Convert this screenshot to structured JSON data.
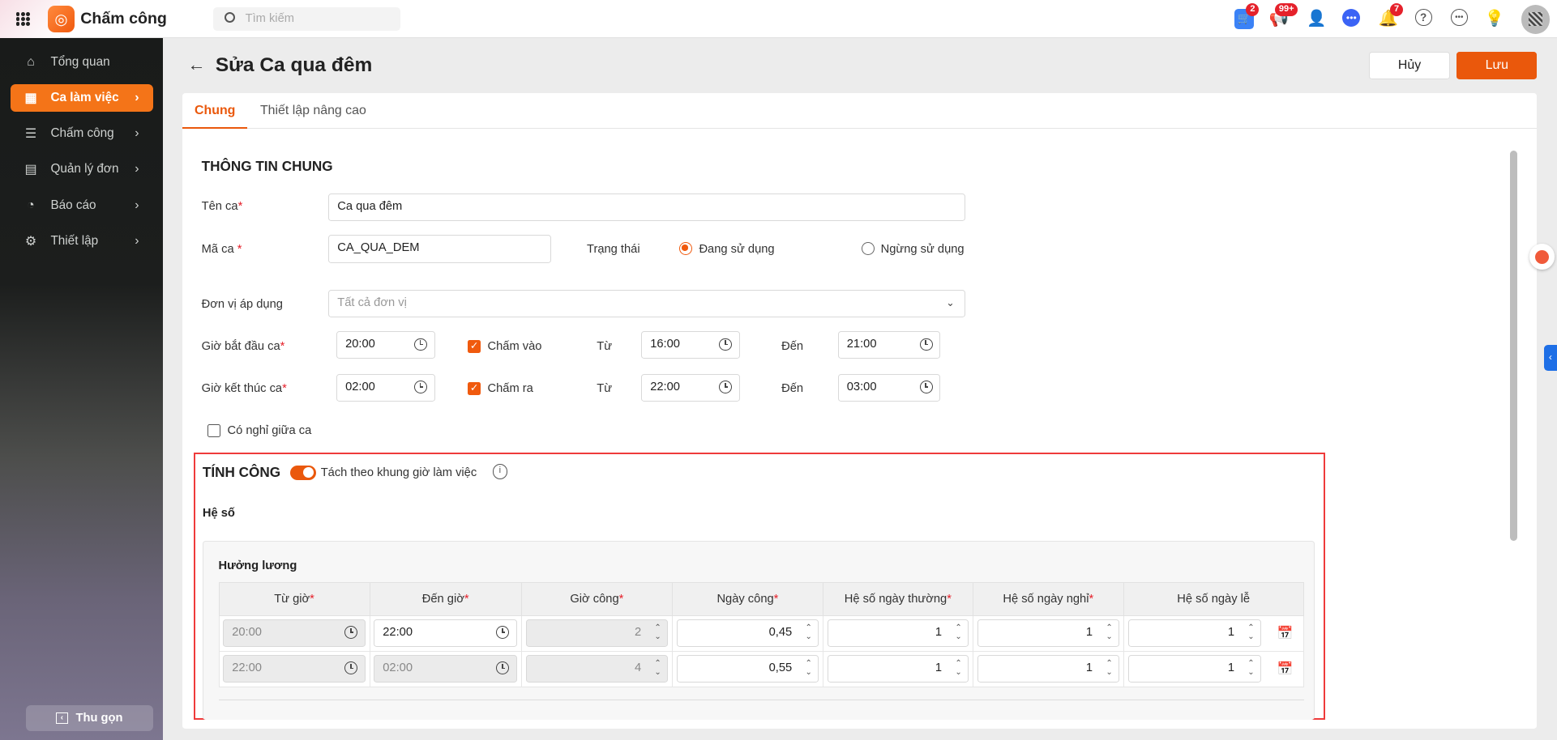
{
  "app": {
    "title": "Chấm công",
    "search_placeholder": "Tìm kiếm"
  },
  "header_icons": {
    "cart_badge": "2",
    "announce_badge": "99+",
    "bell_badge": "7"
  },
  "sidebar": {
    "items": [
      {
        "label": "Tổng quan"
      },
      {
        "label": "Ca làm việc"
      },
      {
        "label": "Chấm công"
      },
      {
        "label": "Quản lý đơn"
      },
      {
        "label": "Báo cáo"
      },
      {
        "label": "Thiết lập"
      }
    ],
    "collapse": "Thu gọn"
  },
  "page": {
    "title": "Sửa Ca qua đêm",
    "cancel": "Hủy",
    "save": "Lưu"
  },
  "tabs": [
    "Chung",
    "Thiết lập nâng cao"
  ],
  "general": {
    "heading": "THÔNG TIN CHUNG",
    "name_label": "Tên ca",
    "name_value": "Ca qua đêm",
    "code_label": "Mã ca",
    "code_value": "CA_QUA_DEM",
    "status_label": "Trạng thái",
    "status_active": "Đang sử dụng",
    "status_inactive": "Ngừng sử dụng",
    "unit_label": "Đơn vị áp dụng",
    "unit_placeholder": "Tất cả đơn vị",
    "start_label": "Giờ bắt đầu ca",
    "start_value": "20:00",
    "checkin_label": "Chấm vào",
    "from_label": "Từ",
    "to_label": "Đến",
    "checkin_from": "16:00",
    "checkin_to": "21:00",
    "end_label": "Giờ kết thúc ca",
    "end_value": "02:00",
    "checkout_label": "Chấm ra",
    "checkout_from": "22:00",
    "checkout_to": "03:00",
    "break_label": "Có nghỉ giữa ca"
  },
  "calc": {
    "heading": "TÍNH CÔNG",
    "toggle_label": "Tách theo khung giờ làm việc",
    "coef_heading": "Hệ số",
    "group": "Hưởng lương",
    "columns": [
      "Từ giờ",
      "Đến giờ",
      "Giờ công",
      "Ngày công",
      "Hệ số ngày thường",
      "Hệ số ngày nghỉ",
      "Hệ số ngày lễ"
    ],
    "rows": [
      {
        "from": "20:00",
        "to": "22:00",
        "hours": "2",
        "days": "0,45",
        "normal": "1",
        "off": "1",
        "holiday": "1"
      },
      {
        "from": "22:00",
        "to": "02:00",
        "hours": "4",
        "days": "0,55",
        "normal": "1",
        "off": "1",
        "holiday": "1"
      }
    ]
  }
}
